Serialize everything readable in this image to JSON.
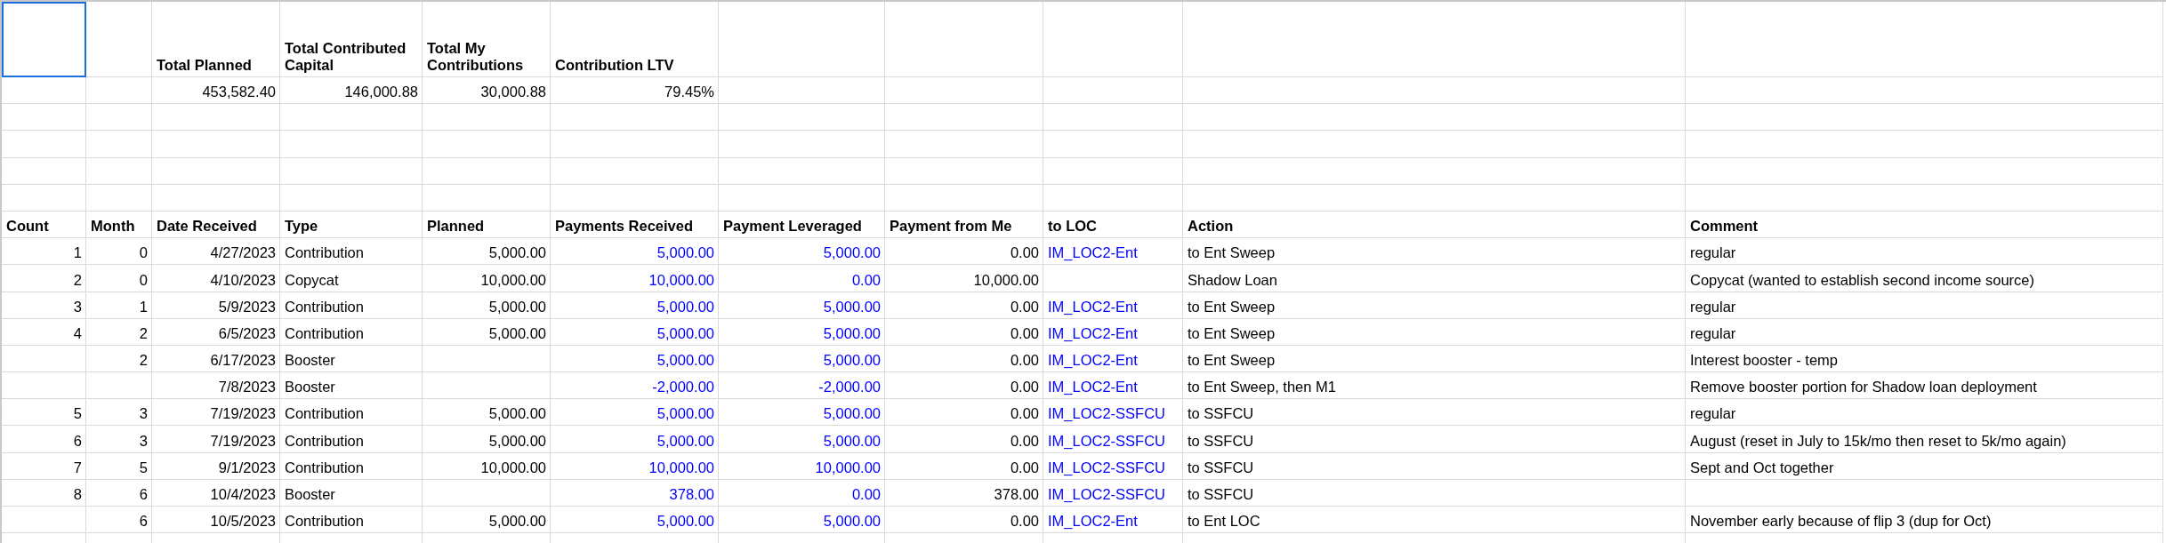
{
  "summary": {
    "corner_cell": {
      "selected": true
    },
    "labels": [
      "Total Planned",
      "Total Contributed Capital",
      "Total My Contributions",
      "Contribution LTV"
    ],
    "values": [
      "453,582.40",
      "146,000.88",
      "30,000.88",
      "79.45%"
    ]
  },
  "table": {
    "columns": [
      {
        "label": "Count",
        "kind": "number"
      },
      {
        "label": "Month",
        "kind": "number"
      },
      {
        "label": "Date Received",
        "kind": "number"
      },
      {
        "label": "Type",
        "kind": "text"
      },
      {
        "label": "Planned",
        "kind": "number"
      },
      {
        "label": "Payments Received",
        "kind": "number",
        "color": "#0000ff"
      },
      {
        "label": "Payment Leveraged",
        "kind": "number",
        "color": "#0000ff"
      },
      {
        "label": "Payment from Me",
        "kind": "number"
      },
      {
        "label": "to LOC",
        "kind": "text",
        "color": "#0000ff"
      },
      {
        "label": "Action",
        "kind": "text"
      },
      {
        "label": "Comment",
        "kind": "text"
      }
    ],
    "rows": [
      {
        "count": "1",
        "month": "0",
        "date_received": "4/27/2023",
        "type": "Contribution",
        "planned": "5,000.00",
        "payments_received": "5,000.00",
        "payment_leveraged": "5,000.00",
        "payment_from_me": "0.00",
        "to_loc": "IM_LOC2-Ent",
        "action": "to Ent Sweep",
        "comment": "regular"
      },
      {
        "count": "2",
        "month": "0",
        "date_received": "4/10/2023",
        "type": "Copycat",
        "planned": "10,000.00",
        "payments_received": "10,000.00",
        "payment_leveraged": "0.00",
        "payment_from_me": "10,000.00",
        "action": "Shadow Loan",
        "comment": "Copycat (wanted to establish second income source)"
      },
      {
        "count": "3",
        "month": "1",
        "date_received": "5/9/2023",
        "type": "Contribution",
        "planned": "5,000.00",
        "payments_received": "5,000.00",
        "payment_leveraged": "5,000.00",
        "payment_from_me": "0.00",
        "to_loc": "IM_LOC2-Ent",
        "action": "to Ent Sweep",
        "comment": "regular"
      },
      {
        "count": "4",
        "month": "2",
        "date_received": "6/5/2023",
        "type": "Contribution",
        "planned": "5,000.00",
        "payments_received": "5,000.00",
        "payment_leveraged": "5,000.00",
        "payment_from_me": "0.00",
        "to_loc": "IM_LOC2-Ent",
        "action": "to Ent Sweep",
        "comment": "regular"
      },
      {
        "month": "2",
        "date_received": "6/17/2023",
        "type": "Booster",
        "payments_received": "5,000.00",
        "payment_leveraged": "5,000.00",
        "payment_from_me": "0.00",
        "to_loc": "IM_LOC2-Ent",
        "action": "to Ent Sweep",
        "comment": "Interest booster - temp"
      },
      {
        "date_received": "7/8/2023",
        "type": "Booster",
        "payments_received": "-2,000.00",
        "payment_leveraged": "-2,000.00",
        "payment_from_me": "0.00",
        "to_loc": "IM_LOC2-Ent",
        "action": "to Ent Sweep, then M1",
        "comment": "Remove booster portion for Shadow loan deployment"
      },
      {
        "count": "5",
        "month": "3",
        "date_received": "7/19/2023",
        "type": "Contribution",
        "planned": "5,000.00",
        "payments_received": "5,000.00",
        "payment_leveraged": "5,000.00",
        "payment_from_me": "0.00",
        "to_loc": "IM_LOC2-SSFCU",
        "action": "to SSFCU",
        "comment": "regular"
      },
      {
        "count": "6",
        "month": "3",
        "date_received": "7/19/2023",
        "type": "Contribution",
        "planned": "5,000.00",
        "payments_received": "5,000.00",
        "payment_leveraged": "5,000.00",
        "payment_from_me": "0.00",
        "to_loc": "IM_LOC2-SSFCU",
        "action": "to SSFCU",
        "comment": "August (reset in July to 15k/mo then reset to 5k/mo again)"
      },
      {
        "count": "7",
        "month": "5",
        "date_received": "9/1/2023",
        "type": "Contribution",
        "planned": "10,000.00",
        "payments_received": "10,000.00",
        "payment_leveraged": "10,000.00",
        "payment_from_me": "0.00",
        "to_loc": "IM_LOC2-SSFCU",
        "action": "to SSFCU",
        "comment": "Sept and Oct together"
      },
      {
        "count": "8",
        "month": "6",
        "date_received": "10/4/2023",
        "type": "Booster",
        "payments_received": "378.00",
        "payment_leveraged": "0.00",
        "payment_from_me": "378.00",
        "to_loc": "IM_LOC2-SSFCU",
        "action": "to SSFCU"
      },
      {
        "month": "6",
        "date_received": "10/5/2023",
        "type": "Contribution",
        "planned": "5,000.00",
        "payments_received": "5,000.00",
        "payment_leveraged": "5,000.00",
        "payment_from_me": "0.00",
        "to_loc": "IM_LOC2-Ent",
        "action": "to Ent LOC",
        "comment": "November early because of flip 3 (dup for Oct)"
      }
    ]
  }
}
